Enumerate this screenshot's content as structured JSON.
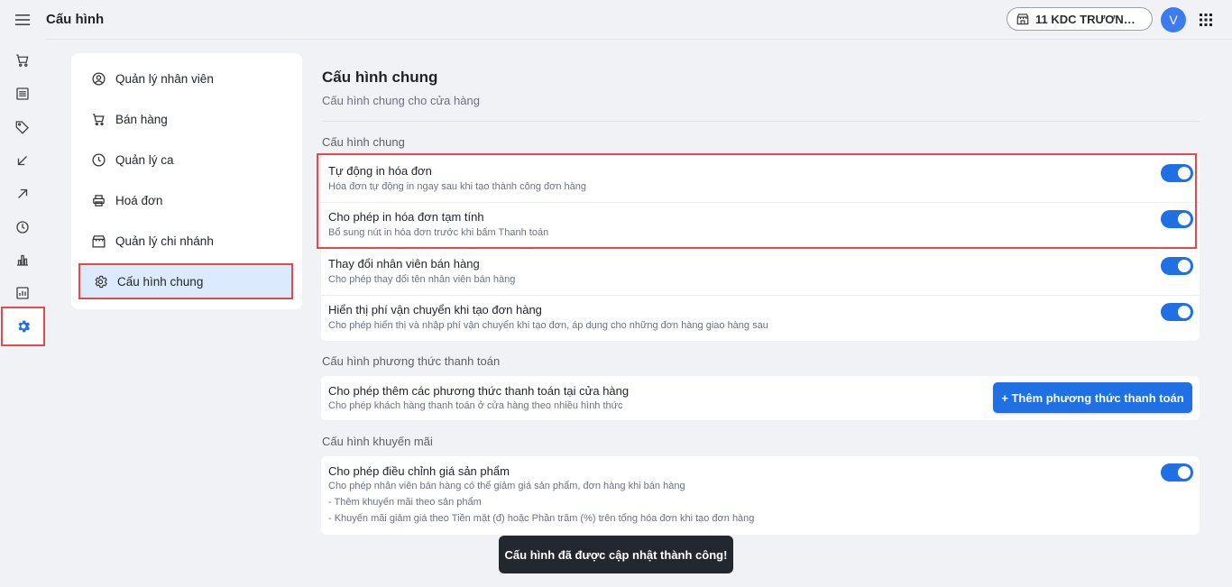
{
  "header": {
    "title": "Cấu hình",
    "store_name": "11 KDC TRƯƠNG Đ...",
    "avatar_initial": "V"
  },
  "rail": {
    "icons": [
      "menu-icon",
      "cart-icon",
      "list-icon",
      "tag-icon",
      "arrow-down-left-icon",
      "arrow-up-right-icon",
      "clock-icon",
      "bar-chart-icon",
      "report-icon",
      "gear-icon"
    ]
  },
  "nav": {
    "items": [
      {
        "label": "Quản lý nhân viên",
        "icon": "user-circle-icon"
      },
      {
        "label": "Bán hàng",
        "icon": "cart-icon"
      },
      {
        "label": "Quản lý ca",
        "icon": "clock-icon"
      },
      {
        "label": "Hoá đơn",
        "icon": "printer-icon"
      },
      {
        "label": "Quản lý chi nhánh",
        "icon": "store-icon"
      },
      {
        "label": "Cấu hình chung",
        "icon": "gear-icon",
        "active": true
      }
    ]
  },
  "main": {
    "title": "Cấu hình chung",
    "subtitle": "Cấu hình chung cho cửa hàng",
    "general": {
      "section_title": "Cấu hình chung",
      "rows": [
        {
          "label": "Tự động in hóa đơn",
          "desc": "Hóa đơn tự động in ngay sau khi tạo thành công đơn hàng",
          "enabled": true
        },
        {
          "label": "Cho phép in hóa đơn tạm tính",
          "desc": "Bổ sung nút in hóa đơn trước khi bấm Thanh toán",
          "enabled": true
        },
        {
          "label": "Thay đổi nhân viên bán hàng",
          "desc": "Cho phép thay đổi tên nhân viên bán hàng",
          "enabled": true
        },
        {
          "label": "Hiển thị phí vận chuyển khi tạo đơn hàng",
          "desc": "Cho phép hiển thị và nhập phí vận chuyển khi tạo đơn, áp dụng cho những đơn hàng giao hàng sau",
          "enabled": true
        }
      ]
    },
    "payment": {
      "section_title": "Cấu hình phương thức thanh toán",
      "label": "Cho phép thêm các phương thức thanh toán tại cửa hàng",
      "desc": "Cho phép khách hàng thanh toán ở cửa hàng theo nhiều hình thức",
      "button_label": "+ Thêm phương thức thanh toán"
    },
    "promo": {
      "section_title": "Cấu hình khuyến mãi",
      "label": "Cho phép điều chỉnh giá sản phẩm",
      "desc": "Cho phép nhân viên bán hàng có thể giảm giá sản phẩm, đơn hàng khi bán hàng",
      "bullet1": "- Thêm khuyến mãi theo sản phẩm",
      "bullet2": "- Khuyến mãi giảm giá theo Tiền mặt (đ) hoặc Phần trăm (%) trên tổng hóa đơn khi tạo đơn hàng",
      "enabled": true
    }
  },
  "toast": {
    "message": "Cấu hình đã được cập nhật thành công!"
  },
  "colors": {
    "accent": "#1f6fe5",
    "highlight": "#e5484d",
    "active_bg": "#dbeafd"
  }
}
